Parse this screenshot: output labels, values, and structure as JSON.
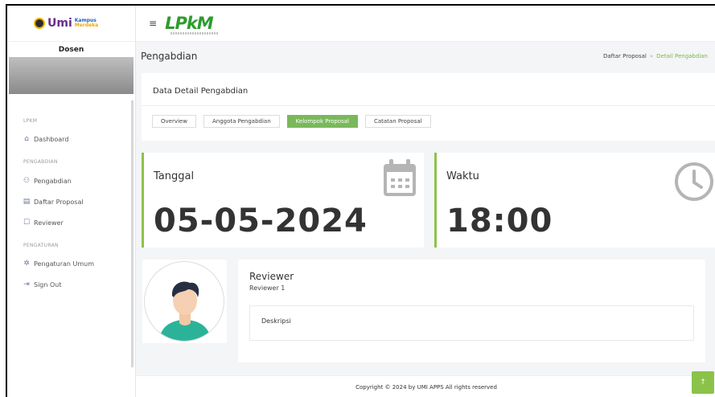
{
  "logo": {
    "brand": "Umi",
    "kampus": "Kampus",
    "merdeka": "Merdeka"
  },
  "user": {
    "name": "Dosen"
  },
  "sidebar": {
    "sections": [
      {
        "label": "LPKM"
      },
      {
        "label": "PENGABDIAN"
      },
      {
        "label": "PENGATURAN"
      }
    ],
    "items": [
      {
        "label": "Dashboard",
        "icon": "home-icon"
      },
      {
        "label": "Pengabdian",
        "icon": "people-icon"
      },
      {
        "label": "Daftar Proposal",
        "icon": "document-icon"
      },
      {
        "label": "Reviewer",
        "icon": "chat-icon"
      },
      {
        "label": "Pengaturan Umum",
        "icon": "gear-icon"
      },
      {
        "label": "Sign Out",
        "icon": "sign-out-icon"
      }
    ]
  },
  "topbar": {
    "brand": "LPkM"
  },
  "header": {
    "title": "Pengabdian",
    "breadcrumb": [
      "Daftar Proposal",
      "Detail Pengabdian"
    ]
  },
  "detail": {
    "title": "Data Detail Pengabdian",
    "tabs": [
      {
        "label": "Overview"
      },
      {
        "label": "Anggota Pengabdian"
      },
      {
        "label": "Kelompok Proposal"
      },
      {
        "label": "Catatan Proposal"
      }
    ],
    "active_tab": "Kelompok Proposal"
  },
  "stats": {
    "date_label": "Tanggal",
    "date_value": "05-05-2024",
    "time_label": "Waktu",
    "time_value": "18:00"
  },
  "reviewer": {
    "title": "Reviewer",
    "name": "Reviewer 1",
    "description_label": "Deskripsi"
  },
  "footer": {
    "copyright": "Copyright © 2024 by UMI APPS All rights reserved"
  },
  "colors": {
    "accent": "#7ab85b",
    "brand": "#2f9b2f"
  }
}
